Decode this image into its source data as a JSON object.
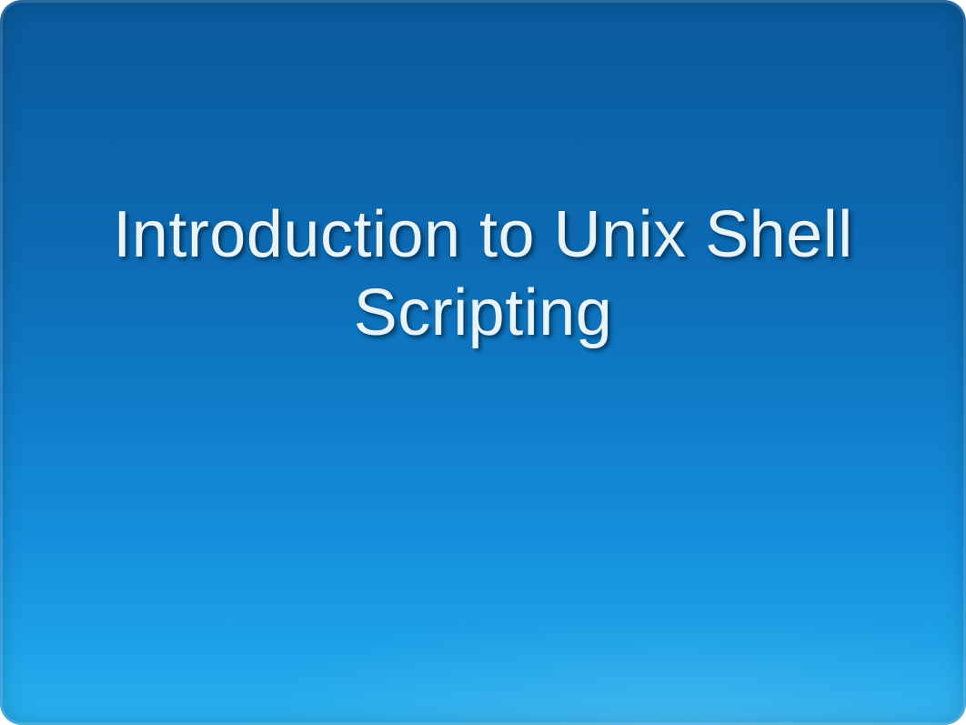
{
  "slide": {
    "title": "Introduction to Unix Shell Scripting"
  }
}
